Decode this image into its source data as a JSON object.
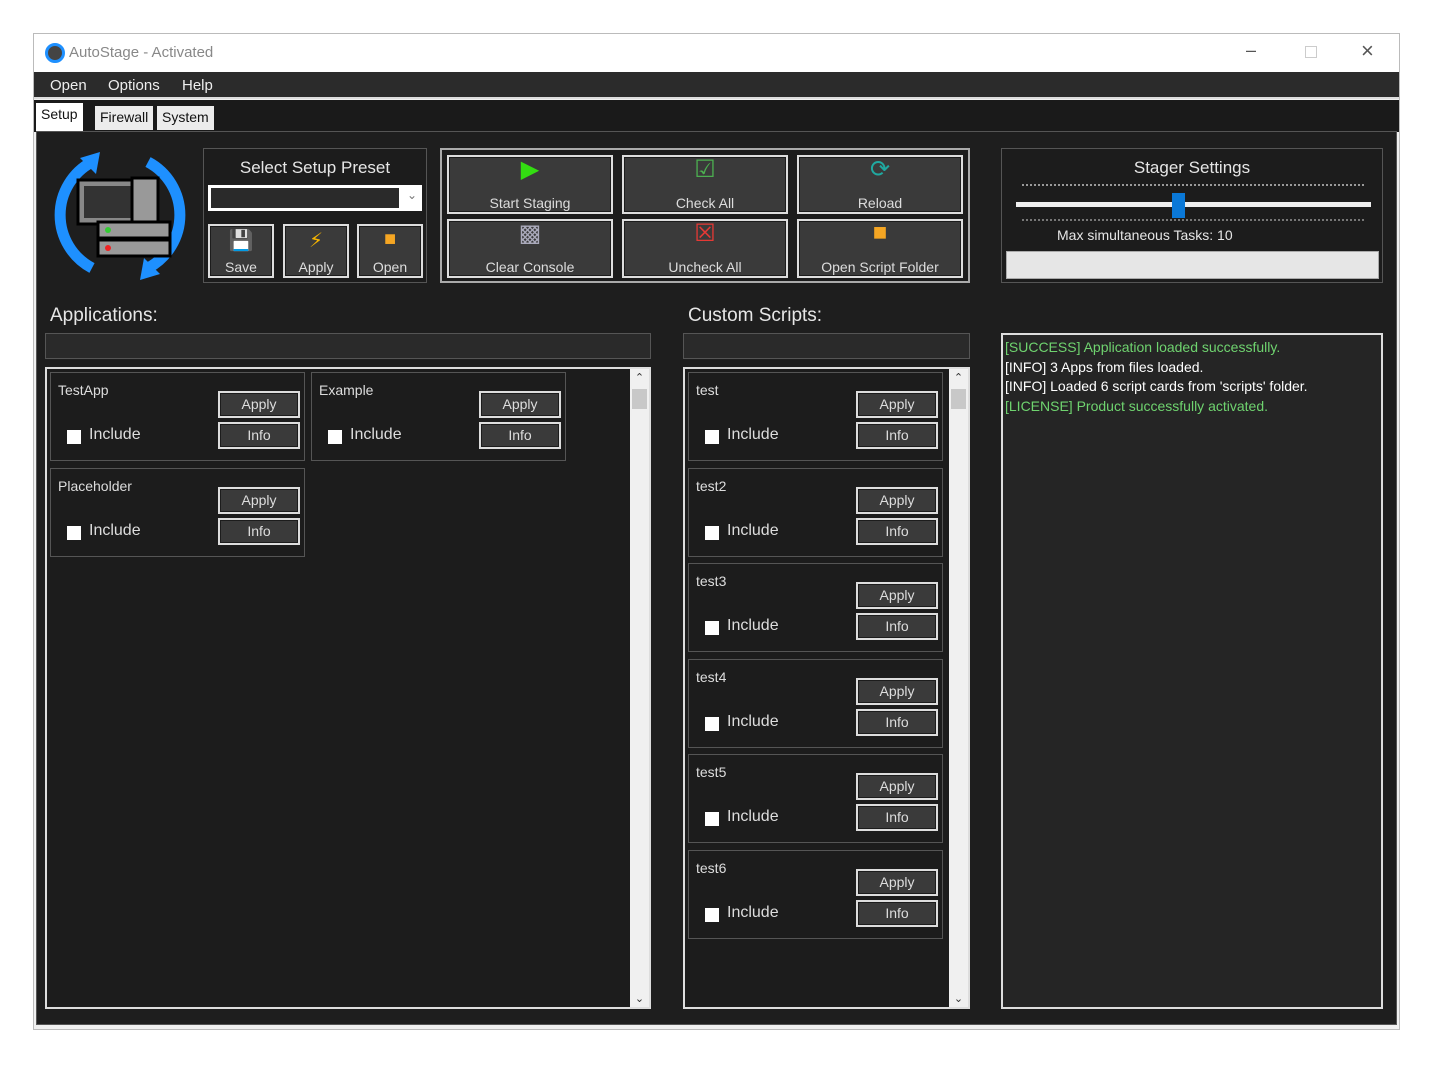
{
  "window": {
    "title": "AutoStage - Activated"
  },
  "menu": [
    "Open",
    "Options",
    "Help"
  ],
  "tabs": [
    "Setup",
    "Firewall",
    "System"
  ],
  "preset": {
    "title": "Select Setup Preset",
    "value": "",
    "buttons": [
      {
        "label": "Save",
        "icon": "floppy-icon"
      },
      {
        "label": "Apply",
        "icon": "lightning-icon"
      },
      {
        "label": "Open",
        "icon": "folder-icon"
      }
    ]
  },
  "actions": [
    {
      "label": "Start Staging",
      "icon": "play-icon"
    },
    {
      "label": "Check All",
      "icon": "checkbox-icon"
    },
    {
      "label": "Reload",
      "icon": "reload-icon"
    },
    {
      "label": "Clear Console",
      "icon": "console-clear-icon"
    },
    {
      "label": "Uncheck All",
      "icon": "x-box-icon"
    },
    {
      "label": "Open Script Folder",
      "icon": "folder-icon"
    }
  ],
  "stager": {
    "title": "Stager Settings",
    "label": "Max simultaneous Tasks: 10",
    "slider_value": 10,
    "slider_min": 1,
    "slider_max": 20
  },
  "applications": {
    "title": "Applications:",
    "filter": "",
    "cards": [
      {
        "name": "TestApp"
      },
      {
        "name": "Example"
      },
      {
        "name": "Placeholder"
      }
    ]
  },
  "scripts": {
    "title": "Custom Scripts:",
    "filter": "",
    "cards": [
      {
        "name": "test"
      },
      {
        "name": "test2"
      },
      {
        "name": "test3"
      },
      {
        "name": "test4"
      },
      {
        "name": "test5"
      },
      {
        "name": "test6"
      }
    ]
  },
  "card_labels": {
    "include": "Include",
    "apply": "Apply",
    "info": "Info"
  },
  "console": [
    {
      "text": "[SUCCESS] Application loaded successfully.",
      "color": "#6fd36f"
    },
    {
      "text": "[INFO] 3 Apps from files loaded.",
      "color": "#ffffff"
    },
    {
      "text": "[INFO] Loaded 6 script cards from 'scripts' folder.",
      "color": "#ffffff"
    },
    {
      "text": "[LICENSE] Product successfully activated.",
      "color": "#6fd36f"
    }
  ]
}
